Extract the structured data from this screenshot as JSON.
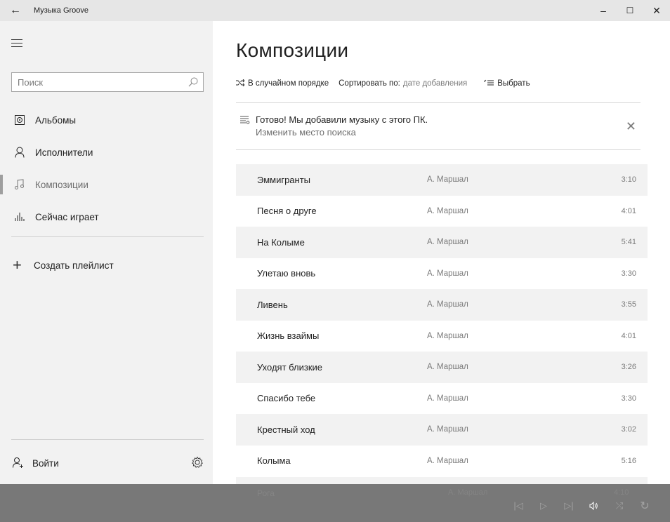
{
  "window": {
    "title": "Музыка Groove",
    "back_glyph": "←",
    "minimize_glyph": "–",
    "maximize_glyph": "☐",
    "close_glyph": "✕"
  },
  "sidebar": {
    "search_placeholder": "Поиск",
    "items": [
      {
        "label": "Альбомы",
        "icon": "album-icon"
      },
      {
        "label": "Исполнители",
        "icon": "artist-icon"
      },
      {
        "label": "Композиции",
        "icon": "note-icon",
        "active": true
      },
      {
        "label": "Сейчас играет",
        "icon": "equalizer-icon"
      }
    ],
    "create_playlist": "Создать плейлист",
    "create_glyph": "+",
    "sign_in": "Войти"
  },
  "main": {
    "title": "Композиции",
    "toolbar": {
      "shuffle_label": "В случайном порядке",
      "sort_label": "Сортировать по:",
      "sort_value": "дате добавления",
      "select_label": "Выбрать"
    },
    "notice": {
      "line1": "Готово! Мы добавили музыку с этого ПК.",
      "line2": "Изменить место поиска",
      "close_glyph": "✕"
    },
    "songs": [
      {
        "title": "Эммигранты",
        "artist": "А. Маршал",
        "duration": "3:10"
      },
      {
        "title": "Песня о друге",
        "artist": "А. Маршал",
        "duration": "4:01"
      },
      {
        "title": "На Колыме",
        "artist": "А. Маршал",
        "duration": "5:41"
      },
      {
        "title": "Улетаю вновь",
        "artist": "А. Маршал",
        "duration": "3:30"
      },
      {
        "title": "Ливень",
        "artist": "А. Маршал",
        "duration": "3:55"
      },
      {
        "title": "Жизнь взаймы",
        "artist": "А. Маршал",
        "duration": "4:01"
      },
      {
        "title": "Уходят близкие",
        "artist": "А. Маршал",
        "duration": "3:26"
      },
      {
        "title": "Спасибо тебе",
        "artist": "А. Маршал",
        "duration": "3:30"
      },
      {
        "title": "Крестный ход",
        "artist": "А. Маршал",
        "duration": "3:02"
      },
      {
        "title": "Колыма",
        "artist": "А. Маршал",
        "duration": "5:16"
      }
    ],
    "peek_song": {
      "title": "Рога",
      "artist": "А. Маршал",
      "duration": "4:10"
    }
  },
  "player": {
    "prev_glyph": "|◁",
    "play_glyph": "▷",
    "next_glyph": "▷|",
    "volume_glyph": "🔊",
    "shuffle_glyph": "⤮",
    "repeat_glyph": "↻"
  },
  "colors": {
    "titlebar": "#e6e6e6",
    "sidebar": "#f2f2f2",
    "row_alt": "#f2f2f2",
    "player": "#6e6e6e"
  }
}
